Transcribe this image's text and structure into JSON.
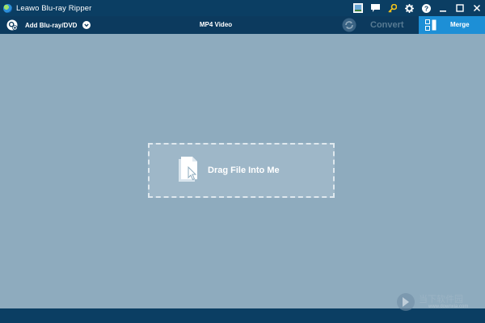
{
  "window": {
    "title": "Leawo Blu-ray Ripper",
    "title_icons": [
      "screenshot-icon",
      "chat-icon",
      "key-icon",
      "gear-icon",
      "help-icon",
      "minimize-icon",
      "maximize-icon",
      "close-icon"
    ]
  },
  "toolbar": {
    "add_label": "Add Blu-ray/DVD",
    "format_label": "MP4 Video",
    "convert_label": "Convert",
    "merge_label": "Merge"
  },
  "dropzone": {
    "label": "Drag File Into Me"
  },
  "watermark": {
    "text": "当下软件园",
    "url": "www.downxia.com"
  },
  "colors": {
    "titlebar": "#0b3e63",
    "toolbar": "#0c3a5e",
    "workspace": "#8eabbe",
    "merge_accent": "#1d8fd6",
    "key_icon": "#f2c21b"
  }
}
